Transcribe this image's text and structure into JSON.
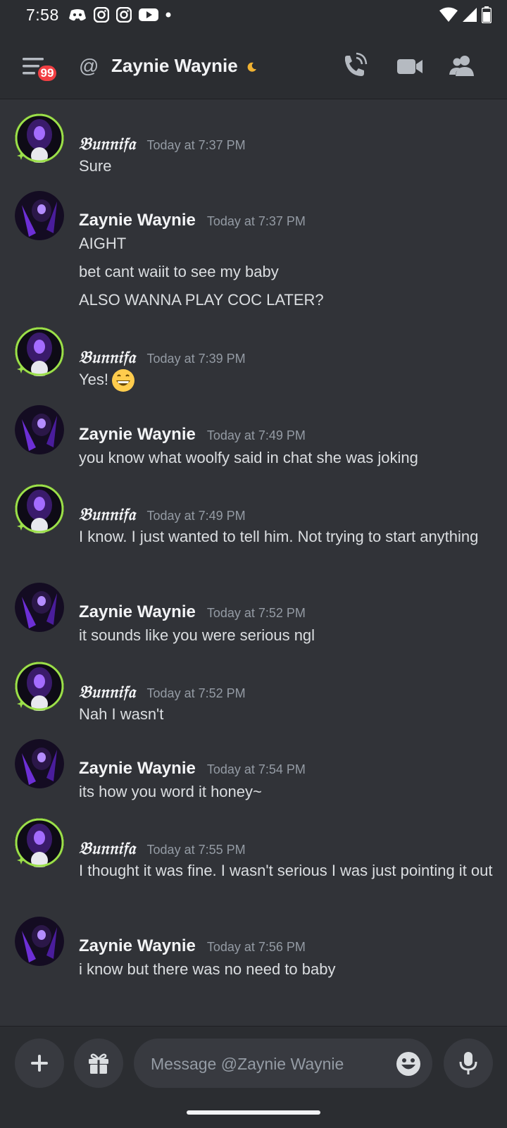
{
  "status_bar": {
    "time": "7:58"
  },
  "header": {
    "unread_badge": "99",
    "at_symbol": "@",
    "title": "Zaynie Waynie"
  },
  "messages": [
    {
      "author": "𝔅𝔲𝔫𝔫𝔦𝔣𝔞",
      "time": "Today at 7:37 PM",
      "lines": [
        "Sure"
      ]
    },
    {
      "author": "Zaynie Waynie",
      "time": "Today at 7:37 PM",
      "lines": [
        "AIGHT",
        "bet cant waiit to see my baby",
        "ALSO WANNA PLAY COC LATER?"
      ]
    },
    {
      "author": "𝔅𝔲𝔫𝔫𝔦𝔣𝔞",
      "time": "Today at 7:39 PM",
      "lines": [
        "Yes!"
      ],
      "emoji": "grinning-face-icon"
    },
    {
      "author": "Zaynie Waynie",
      "time": "Today at 7:49 PM",
      "lines": [
        "you know what woolfy said in chat she was joking"
      ]
    },
    {
      "author": "𝔅𝔲𝔫𝔫𝔦𝔣𝔞",
      "time": "Today at 7:49 PM",
      "lines": [
        "I know. I just wanted to tell him. Not trying to start anything"
      ]
    },
    {
      "author": "Zaynie Waynie",
      "time": "Today at 7:52 PM",
      "lines": [
        "it sounds like you were serious ngl"
      ]
    },
    {
      "author": "𝔅𝔲𝔫𝔫𝔦𝔣𝔞",
      "time": "Today at 7:52 PM",
      "lines": [
        "Nah I wasn't"
      ]
    },
    {
      "author": "Zaynie Waynie",
      "time": "Today at 7:54 PM",
      "lines": [
        "its how you word it honey~"
      ]
    },
    {
      "author": "𝔅𝔲𝔫𝔫𝔦𝔣𝔞",
      "time": "Today at 7:55 PM",
      "lines": [
        "I thought it was fine. I wasn't serious I was just pointing it out"
      ]
    },
    {
      "author": "Zaynie Waynie",
      "time": "Today at 7:56 PM",
      "lines": [
        "i know but there was no need to baby"
      ]
    }
  ],
  "composer": {
    "placeholder": "Message @Zaynie Waynie"
  },
  "colors": {
    "background": "#313338",
    "header": "#2b2d31",
    "badge": "#f23f43",
    "online_status": "#9ce04a",
    "idle_moon": "#f0b232"
  }
}
